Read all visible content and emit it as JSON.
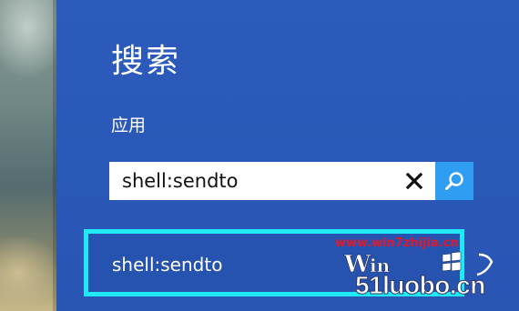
{
  "charm": {
    "title": "搜索",
    "scope": "应用"
  },
  "search": {
    "value": "shell:sendto",
    "clear_icon": "close-icon",
    "search_icon": "search-icon"
  },
  "results": [
    {
      "label": "shell:sendto"
    }
  ],
  "watermark": {
    "url": "www.win7zhijia.cn",
    "logo_text": "51luobo.cn"
  },
  "colors": {
    "panel": "#2b59b8",
    "accent": "#2f9df1",
    "highlight": "#20e8f6",
    "watermark_red": "#e0182d"
  }
}
